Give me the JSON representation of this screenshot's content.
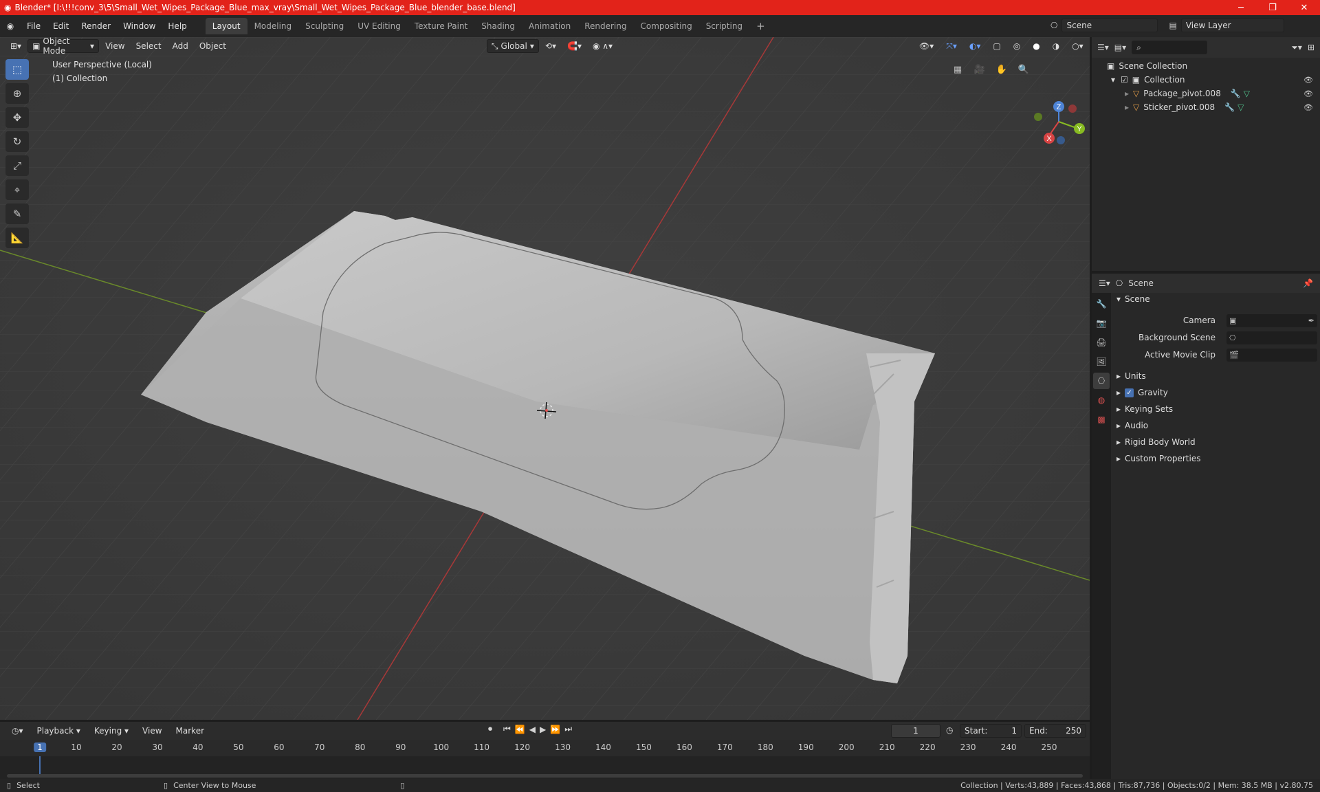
{
  "titlebar": {
    "title": "Blender* [I:\\!!!conv_3\\5\\Small_Wet_Wipes_Package_Blue_max_vray\\Small_Wet_Wipes_Package_Blue_blender_base.blend]"
  },
  "menus": [
    "File",
    "Edit",
    "Render",
    "Window",
    "Help"
  ],
  "workspaces": [
    "Layout",
    "Modeling",
    "Sculpting",
    "UV Editing",
    "Texture Paint",
    "Shading",
    "Animation",
    "Rendering",
    "Compositing",
    "Scripting"
  ],
  "scene_selector": {
    "value": "Scene"
  },
  "view_layer": {
    "value": "View Layer"
  },
  "viewport_header": {
    "mode": "Object Mode",
    "view": "View",
    "select": "Select",
    "add": "Add",
    "object": "Object",
    "orientation": "Global"
  },
  "viewport": {
    "perspective": "User Perspective (Local)",
    "collection": "(1) Collection"
  },
  "gizmo": {
    "z": "Z",
    "y": "Y",
    "x": "X"
  },
  "outliner": {
    "root": "Scene Collection",
    "collection": "Collection",
    "items": [
      "Package_pivot.008",
      "Sticker_pivot.008"
    ]
  },
  "properties": {
    "context": "Scene",
    "panel": "Scene",
    "fields": [
      {
        "label": "Camera",
        "value": ""
      },
      {
        "label": "Background Scene",
        "value": ""
      },
      {
        "label": "Active Movie Clip",
        "value": ""
      }
    ],
    "sections": [
      "Units",
      "Gravity",
      "Keying Sets",
      "Audio",
      "Rigid Body World",
      "Custom Properties"
    ]
  },
  "timeline": {
    "playback": "Playback",
    "keying": "Keying",
    "view": "View",
    "marker": "Marker",
    "current_frame": "1",
    "start_label": "Start:",
    "start": "1",
    "end_label": "End:",
    "end": "250",
    "ticks": [
      "1",
      "10",
      "20",
      "30",
      "40",
      "50",
      "60",
      "70",
      "80",
      "90",
      "100",
      "110",
      "120",
      "130",
      "140",
      "150",
      "160",
      "170",
      "180",
      "190",
      "200",
      "210",
      "220",
      "230",
      "240",
      "250"
    ]
  },
  "statusbar": {
    "select": "Select",
    "center": "Center View to Mouse",
    "stats": "Collection | Verts:43,889 | Faces:43,868 | Tris:87,736 | Objects:0/2 | Mem: 38.5 MB | v2.80.75"
  }
}
